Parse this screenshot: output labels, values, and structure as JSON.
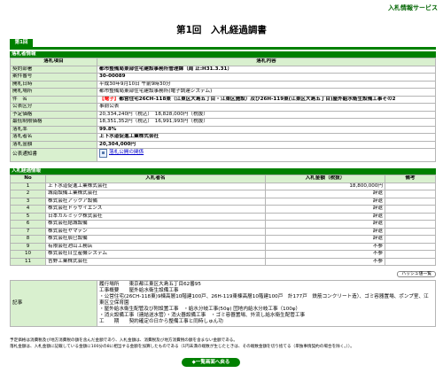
{
  "header": {
    "service_name": "入札情報サービス",
    "title": "第1回　入札経過調書",
    "round_tab": "第1回"
  },
  "info": {
    "section_title": "落札者情報",
    "col_item": "落札項目",
    "col_content": "落札内容",
    "rows": [
      {
        "label": "契約部署",
        "value": "都市整備局東部住宅建設事務所管理課（局 止:H31.3.31）",
        "style": "bold"
      },
      {
        "label": "案件番号",
        "value": "30-00089",
        "style": "bold"
      },
      {
        "label": "開札日時",
        "value": "平成30年9月10日 午前9時30分",
        "style": ""
      },
      {
        "label": "開札場所",
        "value": "都市整備局東部住宅建設事務所(電子調達システム)",
        "style": ""
      }
    ],
    "subject_label": "件　名",
    "subject_tag": "【電子】",
    "subject_text": "都営住宅26CH-118東（江東区大島五丁目・江東区施設）及び26H-119東(江東区大島五丁目)屋外給水衛生設備工事その2",
    "rows2": [
      {
        "label": "公表区分",
        "value": "事前公表",
        "style": ""
      },
      {
        "label": "予定価格",
        "value": "20,334,240円（税込）　18,828,000円（税抜）",
        "style": ""
      },
      {
        "label": "最低制限価格",
        "value": "18,351,352円（税込）　16,991,993円（税抜）",
        "style": ""
      },
      {
        "label": "落札率",
        "value": "99.8%",
        "style": "bold"
      },
      {
        "label": "落札者名",
        "value": "上下水道促進工業株式会社",
        "style": "bold"
      },
      {
        "label": "落札金額",
        "value": "20,304,000円",
        "style": "bold"
      }
    ],
    "notice_label": "公表通知書",
    "notice_link": "落札公開の関係"
  },
  "bids": {
    "section_title": "入札経過情報",
    "col_no": "No",
    "col_name": "入札者名",
    "col_amount": "入札金額（税抜）",
    "col_remarks": "備考",
    "rows": [
      {
        "no": "1",
        "name": "上下水道促進工業株式会社",
        "amount": "18,800,000円",
        "remarks": ""
      },
      {
        "no": "2",
        "name": "城南設備工業株式会社",
        "amount": "辞退",
        "remarks": ""
      },
      {
        "no": "3",
        "name": "株式会社アックア設備",
        "amount": "辞退",
        "remarks": ""
      },
      {
        "no": "4",
        "name": "株式会社ドゥサイエンス",
        "amount": "辞退",
        "remarks": ""
      },
      {
        "no": "5",
        "name": "日本カルミック株式会社",
        "amount": "辞退",
        "remarks": ""
      },
      {
        "no": "6",
        "name": "株式会社結城設備",
        "amount": "辞退",
        "remarks": ""
      },
      {
        "no": "7",
        "name": "株式会社ヤマデン",
        "amount": "辞退",
        "remarks": ""
      },
      {
        "no": "8",
        "name": "株式会社辰巳設備",
        "amount": "辞退",
        "remarks": ""
      },
      {
        "no": "9",
        "name": "有限会社池山工務店",
        "amount": "不参",
        "remarks": ""
      },
      {
        "no": "10",
        "name": "株式会社日立産機システム",
        "amount": "不参",
        "remarks": ""
      },
      {
        "no": "11",
        "name": "吉野工業株式会社",
        "amount": "不参",
        "remarks": ""
      }
    ],
    "hash_button": "ハッシュ値一覧"
  },
  "remarks": {
    "label": "記事",
    "lines": [
      "履行場所　　東京都江東区大島五丁目62番95",
      "工事概要　　屋外給水衛生設備工事",
      "・公営住宅(26CH-118東)9棟高層10階建100戸、26H-119東棟高層10階建100戸　計177戸　鉄筋コンクリート造）、ゴミ容器置場、ポンプ室、江東区立保育園",
      "・屋外給水衛生配管及び附設置工事　・給水分岐工事(50φ) 団地内給水分岐工事（100φ）",
      "・消火設備工事（連結送水管）・消火器設備工事　・ゴミ容器置場、外流し給水衛生配管工事",
      "工　　期　　契約確定の日から整備工事と同時しゅん功"
    ]
  },
  "footer": {
    "note1": "予定価格は消費税及び地方消費税の額を含んだ金額であり、入札金額は、消費税及び地方消費税の額を含まない金額である。",
    "note2": "落札金額は、入札金額に記載している金額に100分の8に相当する金額を加算したものである（1円未満の端数が生じたときは、その端数金額を切り捨てる（単独事情契約の場合を除く。））。",
    "back_button": "◆一覧画面へ戻る"
  }
}
